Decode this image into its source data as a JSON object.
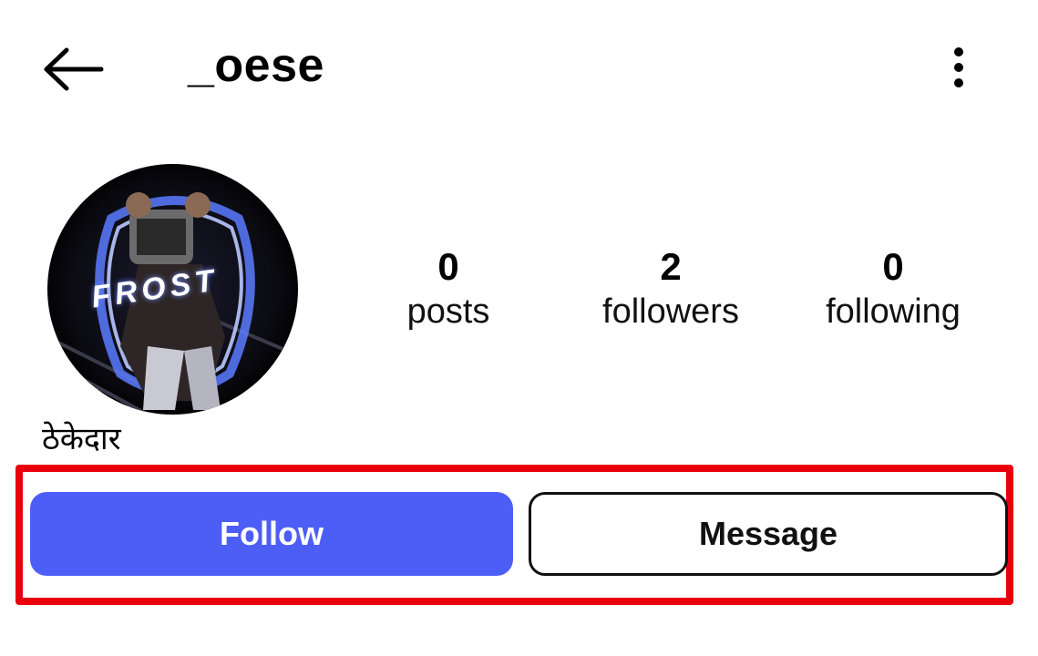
{
  "header": {
    "username": "_oese",
    "back_icon": "arrow-left-icon",
    "more_icon": "vertical-dots-icon"
  },
  "avatar": {
    "overlay_text": "FROST"
  },
  "stats": [
    {
      "count": "0",
      "label": "posts"
    },
    {
      "count": "2",
      "label": "followers"
    },
    {
      "count": "0",
      "label": "following"
    }
  ],
  "profile": {
    "bio_name": "ठेकेदार"
  },
  "actions": {
    "follow_label": "Follow",
    "message_label": "Message"
  },
  "colors": {
    "follow_button": "#4d5ef7",
    "highlight_border": "#e8000d"
  }
}
